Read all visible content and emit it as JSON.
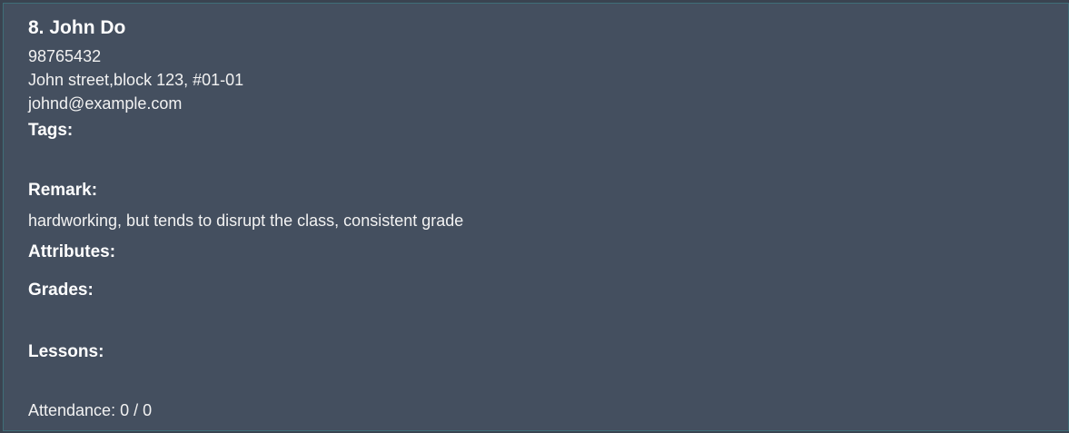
{
  "person": {
    "index": "8.",
    "name": "John Do",
    "phone": "98765432",
    "address": "John street,block 123, #01-01",
    "email": "johnd@example.com"
  },
  "labels": {
    "tags": "Tags:",
    "remark": "Remark:",
    "attributes": "Attributes:",
    "grades": "Grades:",
    "lessons": "Lessons:"
  },
  "remark_text": "hardworking, but tends to disrupt the class, consistent grade",
  "attendance": "Attendance: 0 / 0",
  "colors": {
    "background": "#3a4350",
    "card": "#444f5f",
    "border": "#3f6e78",
    "text": "#ffffff"
  }
}
